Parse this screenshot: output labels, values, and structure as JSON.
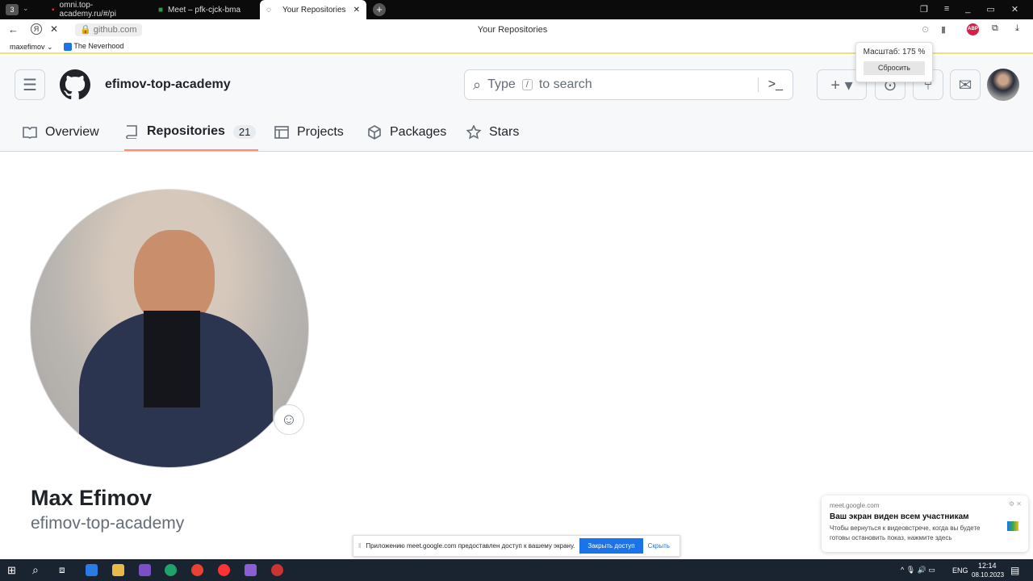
{
  "browser": {
    "tab_count": "3",
    "tabs": [
      {
        "label": "omni.top-academy.ru/#/pi"
      },
      {
        "label": "Meet – pfk-cjck-bma"
      },
      {
        "label": "Your Repositories"
      }
    ],
    "url": "github.com",
    "page_title": "Your Repositories",
    "bookmarks": [
      {
        "label": "maxefimov"
      },
      {
        "label": "The Neverhood"
      }
    ],
    "zoom_popup": {
      "label": "Масштаб: 175 %",
      "reset": "Сбросить"
    },
    "abp": "ABP"
  },
  "github": {
    "org": "efimov-top-academy",
    "search_placeholder": "Type / to search",
    "search_pre": "Type",
    "search_key": "/",
    "search_post": "to search",
    "nav": [
      {
        "label": "Overview"
      },
      {
        "label": "Repositories",
        "count": "21"
      },
      {
        "label": "Projects"
      },
      {
        "label": "Packages"
      },
      {
        "label": "Stars"
      }
    ],
    "profile": {
      "name": "Max Efimov",
      "username": "efimov-top-academy"
    },
    "accent": "#fd8c73"
  },
  "share_bar": {
    "text": "Приложению meet.google.com предоставлен доступ к вашему экрану.",
    "stop": "Закрыть доступ",
    "hide": "Скрыть"
  },
  "notification": {
    "source": "meet.google.com",
    "title": "Ваш экран виден всем участникам",
    "body": "Чтобы вернуться к видеовстрече, когда вы будете готовы остановить показ, нажмите здесь"
  },
  "taskbar": {
    "lang": "ENG",
    "time": "12:14",
    "date": "08.10.2023"
  }
}
